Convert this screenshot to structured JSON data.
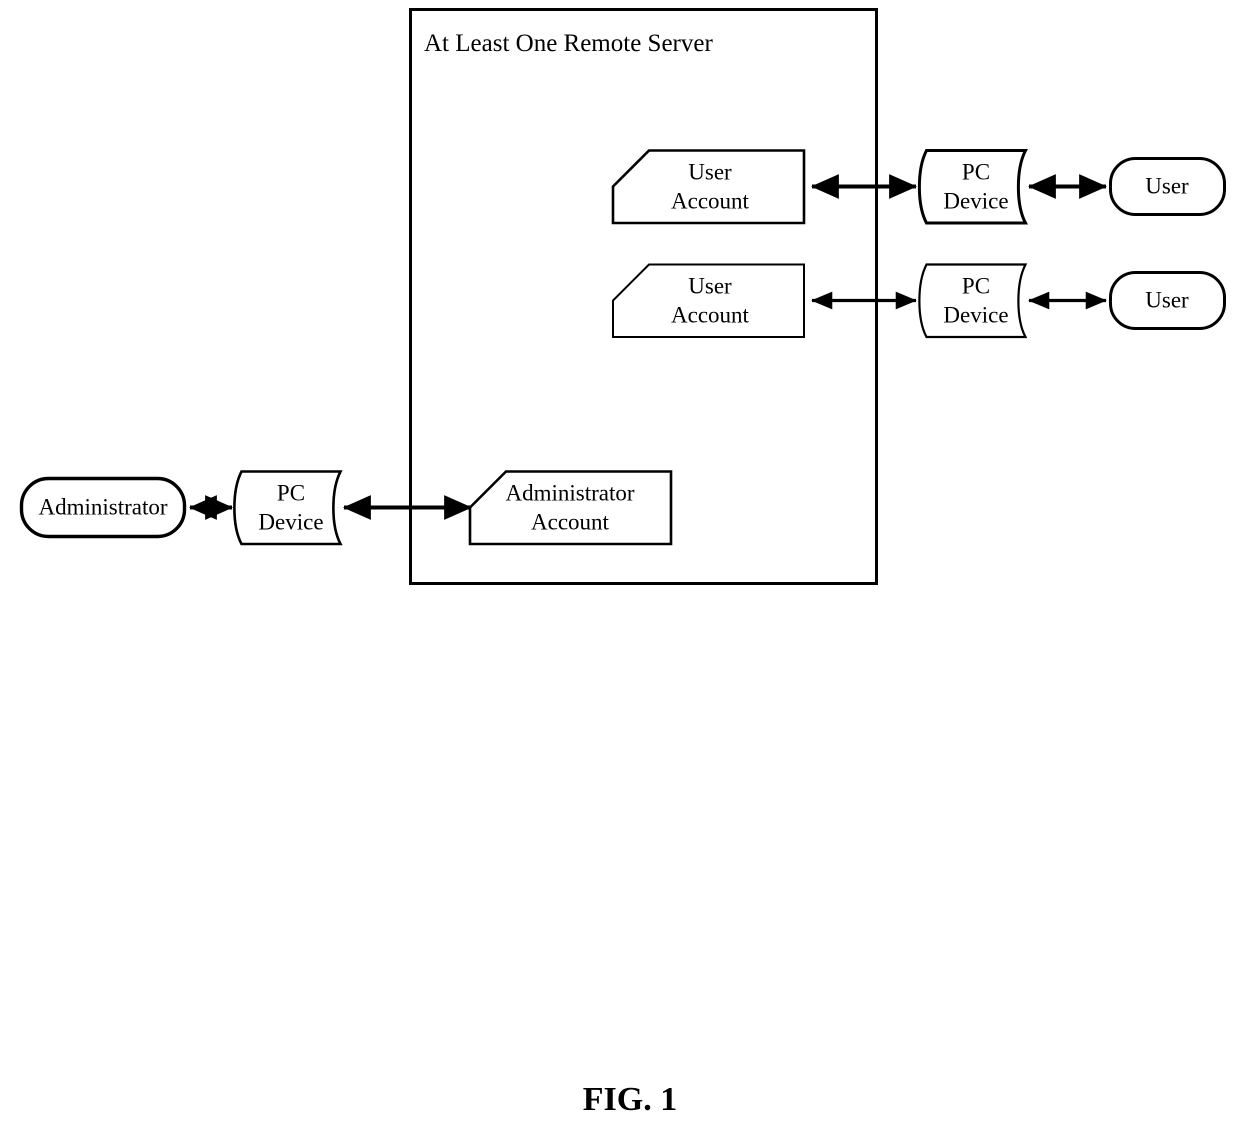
{
  "figure": {
    "caption": "FIG. 1",
    "container": {
      "title": "At Least One Remote Server"
    },
    "colors": {
      "stroke": "#000000",
      "fill": "#ffffff",
      "text": "#000000",
      "background": "#ffffff"
    },
    "nodes": {
      "user_account_1": {
        "line1": "User",
        "line2": "Account"
      },
      "user_account_2": {
        "line1": "User",
        "line2": "Account"
      },
      "administrator_account": {
        "line1": "Administrator",
        "line2": "Account"
      },
      "pc_device_1": {
        "line1": "PC",
        "line2": "Device"
      },
      "pc_device_2": {
        "line1": "PC",
        "line2": "Device"
      },
      "pc_device_admin": {
        "line1": "PC",
        "line2": "Device"
      },
      "user_1": {
        "label": "User"
      },
      "user_2": {
        "label": "User"
      },
      "administrator": {
        "label": "Administrator"
      }
    },
    "connectors": [
      {
        "name": "user-account-1-to-pc-device-1",
        "kind": "bidirectional-arrow"
      },
      {
        "name": "pc-device-1-to-user-1",
        "kind": "bidirectional-arrow"
      },
      {
        "name": "user-account-2-to-pc-device-2",
        "kind": "bidirectional-arrow"
      },
      {
        "name": "pc-device-2-to-user-2",
        "kind": "bidirectional-arrow"
      },
      {
        "name": "administrator-to-pc-device-admin",
        "kind": "bidirectional-arrow"
      },
      {
        "name": "pc-device-admin-to-administrator-account",
        "kind": "bidirectional-arrow"
      }
    ]
  }
}
